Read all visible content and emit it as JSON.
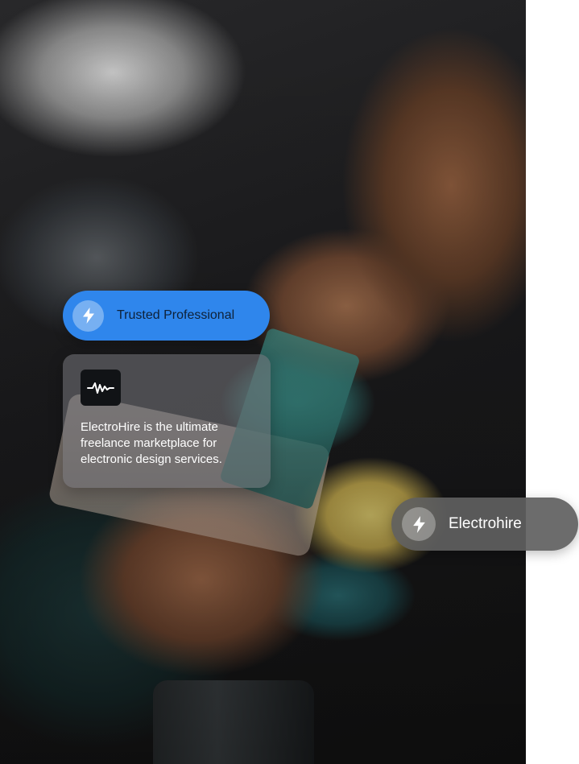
{
  "photo": {
    "subject": "technician-repairing-phone-icon"
  },
  "badge_trusted": {
    "label": "Trusted Professional",
    "icon": "lightning-icon",
    "color": "#2f86ec"
  },
  "info_card": {
    "icon": "waveform-icon",
    "description": "ElectroHire is the ultimate freelance marketplace for electronic design services."
  },
  "badge_brand": {
    "label": "Electrohire",
    "icon": "lightning-icon",
    "color": "#5f5f5f"
  }
}
